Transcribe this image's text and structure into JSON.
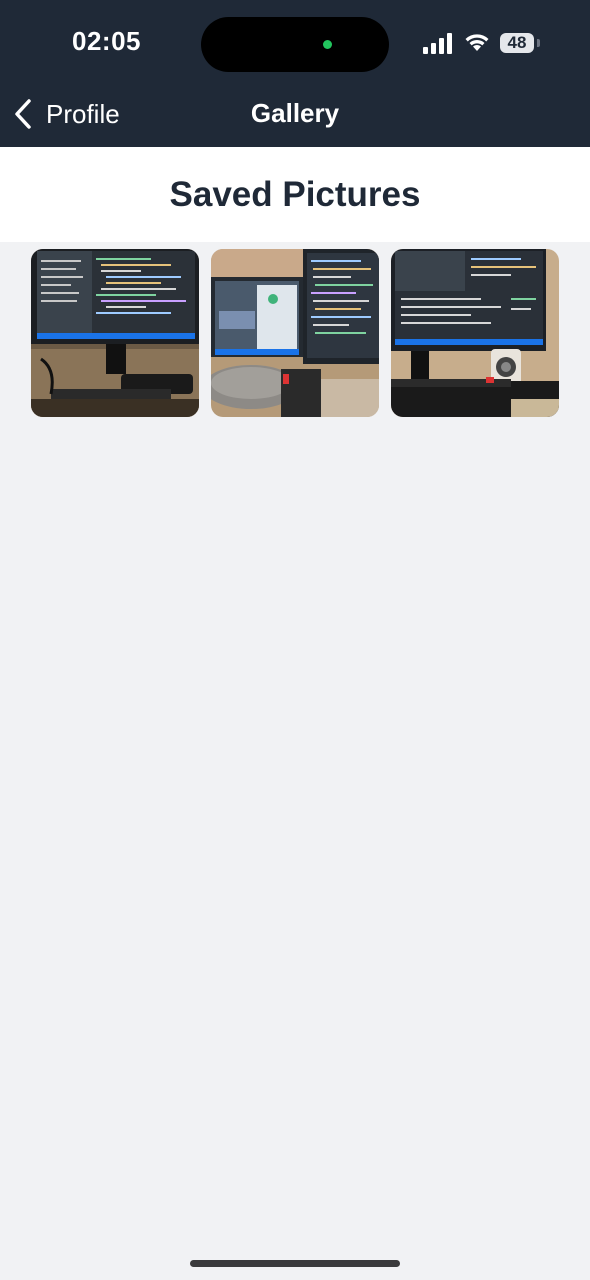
{
  "status_bar": {
    "time": "02:05",
    "battery": "48"
  },
  "nav": {
    "back_label": "Profile",
    "title": "Gallery"
  },
  "page": {
    "heading": "Saved Pictures"
  },
  "colors": {
    "header_bg": "#1f2937",
    "page_bg": "#f1f2f4",
    "heading_text": "#1f2937",
    "camera_dot": "#22c55e"
  },
  "gallery": {
    "items": [
      {
        "alt": "photo-1"
      },
      {
        "alt": "photo-2"
      },
      {
        "alt": "photo-3"
      }
    ]
  }
}
